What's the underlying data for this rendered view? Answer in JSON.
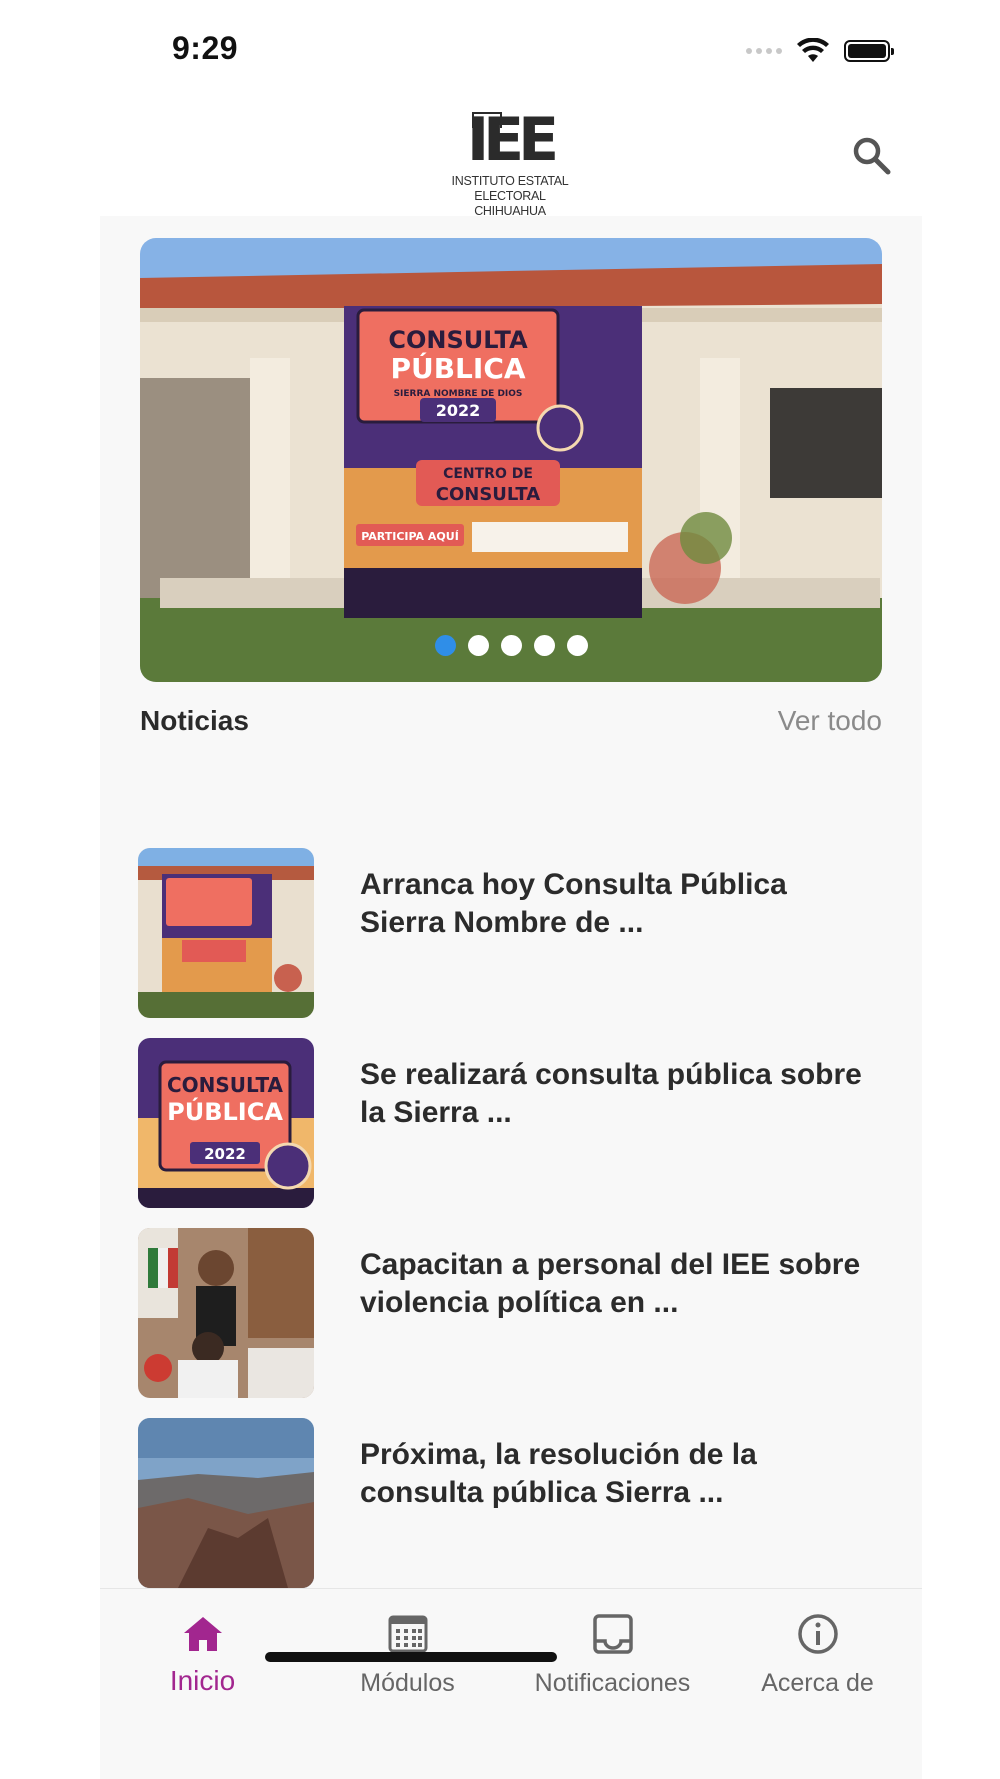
{
  "status": {
    "time": "9:29"
  },
  "header": {
    "logo_letters": "IEE",
    "logo_line1": "INSTITUTO ESTATAL ELECTORAL",
    "logo_line2": "CHIHUAHUA",
    "search_icon": "search-icon"
  },
  "carousel": {
    "banner_title1": "CONSULTA",
    "banner_title2": "PÚBLICA",
    "banner_sub": "SIERRA NOMBRE DE DIOS",
    "banner_year": "2022",
    "banner_center1": "CENTRO DE",
    "banner_center2": "CONSULTA",
    "banner_cta": "PARTICIPA AQUÍ",
    "slide_count": 5,
    "active_index": 0
  },
  "news": {
    "section_title": "Noticias",
    "see_all": "Ver todo",
    "items": [
      {
        "title": "Arranca hoy Consulta Pública Sierra Nombre de ..."
      },
      {
        "title": "Se realizará consulta pública sobre la Sierra ..."
      },
      {
        "title": "Capacitan a personal del IEE sobre violencia política en ..."
      },
      {
        "title": "Próxima, la resolución de la consulta pública Sierra ..."
      }
    ]
  },
  "tabbar": {
    "tabs": [
      {
        "label": "Inicio",
        "icon": "home-icon",
        "active": true
      },
      {
        "label": "Módulos",
        "icon": "calendar-grid-icon",
        "active": false
      },
      {
        "label": "Notificaciones",
        "icon": "inbox-icon",
        "active": false
      },
      {
        "label": "Acerca de",
        "icon": "info-icon",
        "active": false
      }
    ]
  },
  "colors": {
    "accent": "#a2268f",
    "dot_active": "#2f8ee8"
  }
}
